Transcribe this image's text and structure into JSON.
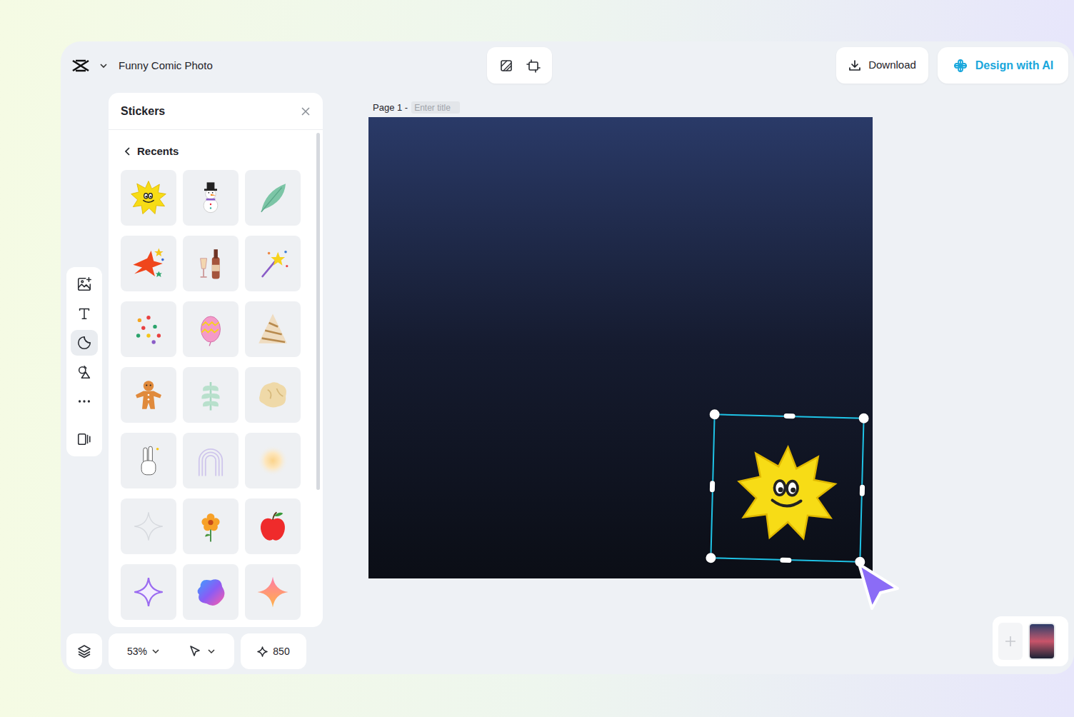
{
  "app": {
    "document_title": "Funny Comic Photo"
  },
  "header": {
    "download": "Download",
    "design_ai": "Design with AI"
  },
  "rail": [
    {
      "kind": "image",
      "selected": false
    },
    {
      "kind": "text",
      "selected": false
    },
    {
      "kind": "sticker",
      "selected": true
    },
    {
      "kind": "shapes",
      "selected": false
    },
    {
      "kind": "more",
      "selected": false
    },
    {
      "kind": "templates",
      "selected": false
    }
  ],
  "stickers_panel": {
    "title": "Stickers",
    "back_label": "Recents",
    "items": [
      {
        "kind": "sun"
      },
      {
        "kind": "snowman"
      },
      {
        "kind": "feather"
      },
      {
        "kind": "burst"
      },
      {
        "kind": "bottle"
      },
      {
        "kind": "sparkler"
      },
      {
        "kind": "confetti"
      },
      {
        "kind": "egg"
      },
      {
        "kind": "tree"
      },
      {
        "kind": "gingerbread"
      },
      {
        "kind": "leaf"
      },
      {
        "kind": "rock"
      },
      {
        "kind": "peace"
      },
      {
        "kind": "rainbow"
      },
      {
        "kind": "glow"
      },
      {
        "kind": "outline-sparkle"
      },
      {
        "kind": "flower"
      },
      {
        "kind": "apple"
      },
      {
        "kind": "purple-sparkle"
      },
      {
        "kind": "blob"
      },
      {
        "kind": "gradient-star"
      }
    ]
  },
  "page": {
    "label": "Page 1 -",
    "title_placeholder": "Enter title"
  },
  "canvas": {
    "sticker": {
      "kind": "sun",
      "selected": true
    }
  },
  "footer": {
    "zoom": "53%",
    "credits": "850"
  }
}
